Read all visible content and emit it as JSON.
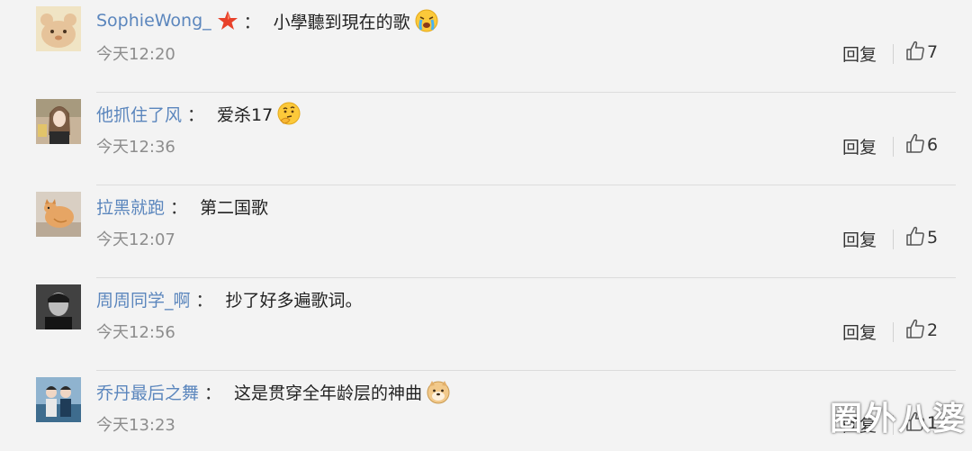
{
  "comments": [
    {
      "username": "SophieWong_",
      "badge": "red-star-icon",
      "colon": "：",
      "content": "小學聽到現在的歌",
      "emoji": "crying-emoji",
      "time": "今天12:20",
      "reply_label": "回复",
      "likes": "7"
    },
    {
      "username": "他抓住了风",
      "colon": "：",
      "content": "爱杀17",
      "emoji": "thinking-emoji",
      "time": "今天12:36",
      "reply_label": "回复",
      "likes": "6"
    },
    {
      "username": "拉黑就跑",
      "colon": "：",
      "content": "第二国歌",
      "time": "今天12:07",
      "reply_label": "回复",
      "likes": "5"
    },
    {
      "username": "周周同学_啊",
      "colon": "：",
      "content": "抄了好多遍歌词。",
      "time": "今天12:56",
      "reply_label": "回复",
      "likes": "2"
    },
    {
      "username": "乔丹最后之舞",
      "colon": "：",
      "content": "这是贯穿全年龄层的神曲",
      "emoji": "doge-emoji",
      "time": "今天13:23",
      "reply_label": "回复",
      "likes": "1"
    }
  ],
  "watermark": "圈外八婆",
  "colors": {
    "background": "#f3f3f3",
    "username": "#5b86bd",
    "time": "#8d8d8d",
    "divider": "#dcdcdc"
  }
}
